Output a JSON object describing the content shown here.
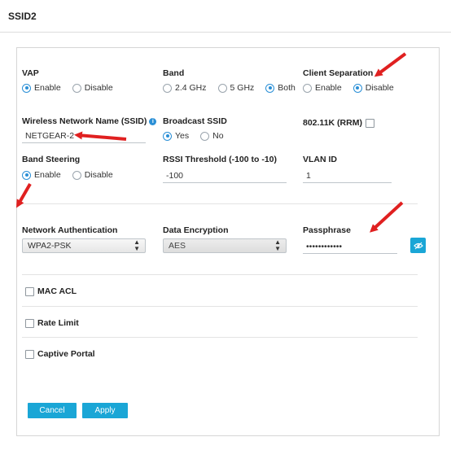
{
  "header": {
    "title": "SSID2"
  },
  "vap": {
    "label": "VAP",
    "options": [
      "Enable",
      "Disable"
    ],
    "selected": "Enable"
  },
  "band": {
    "label": "Band",
    "options": [
      "2.4 GHz",
      "5 GHz",
      "Both"
    ],
    "selected": "Both"
  },
  "client_separation": {
    "label": "Client Separation",
    "options": [
      "Enable",
      "Disable"
    ],
    "selected": "Disable"
  },
  "ssid": {
    "label": "Wireless Network Name (SSID)",
    "value": "NETGEAR-2",
    "info_icon": "info-icon"
  },
  "broadcast_ssid": {
    "label": "Broadcast SSID",
    "options": [
      "Yes",
      "No"
    ],
    "selected": "Yes"
  },
  "rrm": {
    "label": "802.11K (RRM)",
    "checked": false
  },
  "band_steering": {
    "label": "Band Steering",
    "options": [
      "Enable",
      "Disable"
    ],
    "selected": "Enable"
  },
  "rssi": {
    "label": "RSSI Threshold (-100 to -10)",
    "value": "-100"
  },
  "vlan": {
    "label": "VLAN ID",
    "value": "1"
  },
  "network_auth": {
    "label": "Network Authentication",
    "value": "WPA2-PSK"
  },
  "data_encryption": {
    "label": "Data Encryption",
    "value": "AES"
  },
  "passphrase": {
    "label": "Passphrase",
    "value": "••••••••••••",
    "toggle_icon": "eye-icon"
  },
  "mac_acl": {
    "label": "MAC ACL",
    "checked": false
  },
  "rate_limit": {
    "label": "Rate Limit",
    "checked": false
  },
  "captive_portal": {
    "label": "Captive Portal",
    "checked": false
  },
  "buttons": {
    "cancel": "Cancel",
    "apply": "Apply"
  },
  "colors": {
    "accent": "#1aa6d6",
    "radio": "#2a8fd6",
    "arrow": "#e02020"
  }
}
